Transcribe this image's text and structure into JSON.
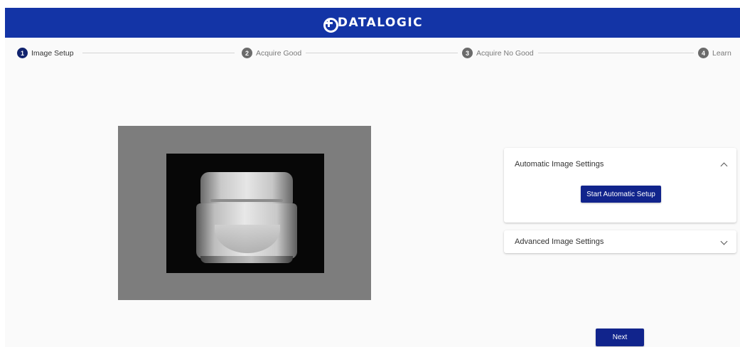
{
  "header": {
    "logo_text": "DATALOGIC",
    "brand_color": "#1334a6"
  },
  "stepper": {
    "steps": [
      {
        "number": "1",
        "label": "Image Setup",
        "active": true
      },
      {
        "number": "2",
        "label": "Acquire Good",
        "active": false
      },
      {
        "number": "3",
        "label": "Acquire No Good",
        "active": false
      },
      {
        "number": "4",
        "label": "Learn",
        "active": false
      }
    ]
  },
  "automatic_settings": {
    "title": "Automatic Image Settings",
    "expanded": true,
    "button_label": "Start Automatic Setup"
  },
  "advanced_settings": {
    "title": "Advanced Image Settings",
    "expanded": false
  },
  "footer": {
    "next_label": "Next"
  }
}
